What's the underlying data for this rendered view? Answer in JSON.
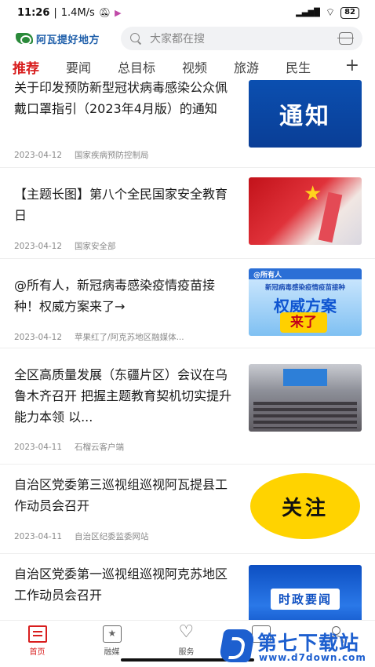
{
  "status_bar": {
    "time": "11:26",
    "speed": "1.4M/s",
    "signal_label": "HD",
    "battery": "82"
  },
  "header": {
    "app_name": "阿瓦提好地方",
    "search_placeholder": "大家都在搜"
  },
  "tabs": [
    {
      "label": "推荐",
      "active": true
    },
    {
      "label": "要闻",
      "active": false
    },
    {
      "label": "总目标",
      "active": false
    },
    {
      "label": "视频",
      "active": false
    },
    {
      "label": "旅游",
      "active": false
    },
    {
      "label": "民生",
      "active": false
    }
  ],
  "tab_add": "+",
  "articles": [
    {
      "title": "关于印发预防新型冠状病毒感染公众佩戴口罩指引（2023年4月版）的通知",
      "date": "2023-04-12",
      "source": "国家疾病预防控制局",
      "thumb_text": "通知"
    },
    {
      "title": "【主题长图】第八个全民国家安全教育日",
      "date": "2023-04-12",
      "source": "国家安全部",
      "thumb_text": ""
    },
    {
      "title": "@所有人，新冠病毒感染疫情疫苗接种！权威方案来了→",
      "date": "2023-04-12",
      "source": "苹果红了/阿克苏地区融媒体...",
      "thumb_tag": "@所有人",
      "thumb_line1": "新冠病毒感染疫情疫苗接种",
      "thumb_line2": "权威方案",
      "thumb_line3": "来了"
    },
    {
      "title": "全区高质量发展（东疆片区）会议在乌鲁木齐召开 把握主题教育契机切实提升能力本领 以...",
      "date": "2023-04-11",
      "source": "石榴云客户端",
      "thumb_text": ""
    },
    {
      "title": "自治区党委第三巡视组巡视阿瓦提县工作动员会召开",
      "date": "2023-04-11",
      "source": "自治区纪委监委网站",
      "thumb_text": "关注"
    },
    {
      "title": "自治区党委第一巡视组巡视阿克苏地区工作动员会召开",
      "date": "",
      "source": "",
      "thumb_text": "时政要闻"
    }
  ],
  "bottom_nav": [
    {
      "label": "首页",
      "icon": "news-icon",
      "active": true
    },
    {
      "label": "融媒",
      "icon": "media-icon",
      "active": false
    },
    {
      "label": "服务",
      "icon": "heart-icon",
      "active": false
    },
    {
      "label": "",
      "icon": "square-icon",
      "active": false
    },
    {
      "label": "",
      "icon": "user-icon",
      "active": false
    }
  ],
  "watermark": {
    "title": "第七下载站",
    "url": "www.d7down.com"
  }
}
